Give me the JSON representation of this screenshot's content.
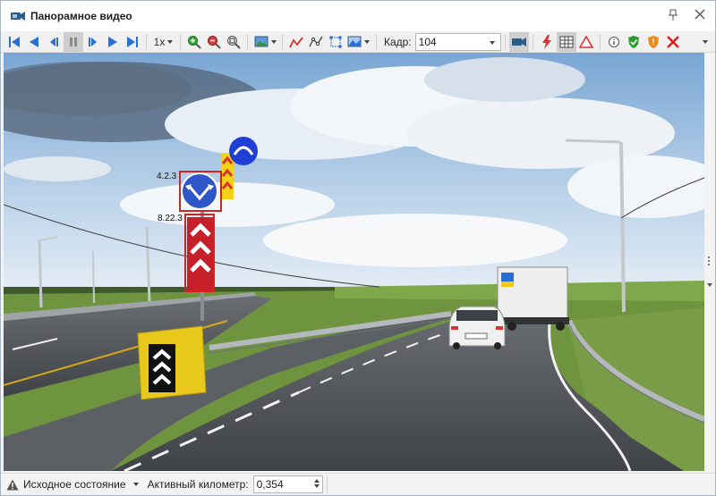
{
  "window": {
    "title": "Панорамное видео",
    "icon": "video-camera-icon",
    "pin_icon": "pin-icon",
    "close_icon": "close-icon"
  },
  "toolbar": {
    "speed": "1x",
    "frame_label": "Кадр:",
    "frame_value": "104",
    "buttons": [
      "first-frame-icon",
      "previous-frame-icon",
      "step-back-icon",
      "pause-icon",
      "step-forward-icon",
      "play-icon",
      "last-frame-icon",
      "zoom-in-icon",
      "zoom-out-icon",
      "zoom-fit-icon",
      "image-settings-icon",
      "route-icon",
      "polyline-icon",
      "edit-points-icon",
      "landscape-icon",
      "camera-icon",
      "lightning-icon",
      "table-icon",
      "triangle-warning-icon",
      "info-icon",
      "green-shield-icon",
      "orange-shield-icon",
      "red-cross-icon"
    ]
  },
  "viewport": {
    "sign_labels": [
      "4.2.3",
      "8.22.3"
    ]
  },
  "statusbar": {
    "state_icon": "warning-icon",
    "state_text": "Исходное состояние",
    "km_label": "Активный километр:",
    "km_value": "0,354"
  },
  "colors": {
    "sky": "#8fb6df",
    "asphalt": "#4f5357",
    "grass": "#6f9440",
    "detection_box": "#d92020",
    "sign_blue": "#2e56c8"
  }
}
